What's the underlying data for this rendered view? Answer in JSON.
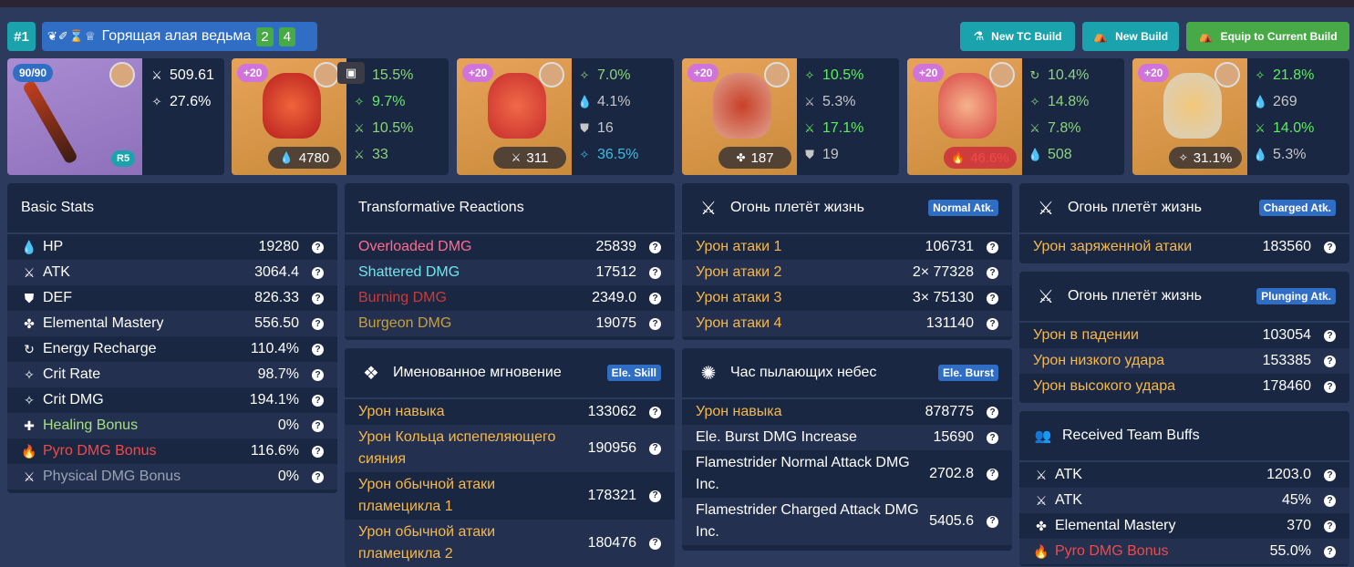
{
  "header": {
    "rank": "#1",
    "set_icons": "❦✐⌛♕",
    "set_name": "Горящая алая ведьма",
    "set_count_a": "2",
    "set_count_b": "4"
  },
  "buttons": {
    "new_tc": "New TC Build",
    "new_build": "New Build",
    "equip": "Equip to Current Build"
  },
  "weapon": {
    "level": "90/90",
    "refine": "R5",
    "stats": [
      {
        "icon": "⚔",
        "value": "509.61"
      },
      {
        "icon": "✧",
        "value": "27.6%"
      }
    ]
  },
  "artifacts": [
    {
      "level": "+20",
      "main": "4780",
      "main_icon": "💧",
      "subs": [
        {
          "icon": "✧",
          "value": "15.5%",
          "c": "gr"
        },
        {
          "icon": "✧",
          "value": "9.7%",
          "c": "bgr"
        },
        {
          "icon": "⚔",
          "value": "10.5%",
          "c": "gr"
        },
        {
          "icon": "⚔",
          "value": "33",
          "c": "gr"
        }
      ]
    },
    {
      "level": "+20",
      "main": "311",
      "main_icon": "⚔",
      "subs": [
        {
          "icon": "✧",
          "value": "7.0%",
          "c": "gr"
        },
        {
          "icon": "💧",
          "value": "4.1%",
          "c": "gy"
        },
        {
          "icon": "⛊",
          "value": "16",
          "c": "gy"
        },
        {
          "icon": "✧",
          "value": "36.5%",
          "c": "cy"
        }
      ]
    },
    {
      "level": "+20",
      "main": "187",
      "main_icon": "✤",
      "subs": [
        {
          "icon": "✧",
          "value": "10.5%",
          "c": "bgr"
        },
        {
          "icon": "⚔",
          "value": "5.3%",
          "c": "gy"
        },
        {
          "icon": "⚔",
          "value": "17.1%",
          "c": "bgr"
        },
        {
          "icon": "⛊",
          "value": "19",
          "c": "gy"
        }
      ]
    },
    {
      "level": "+20",
      "main": "46.6%",
      "main_icon": "🔥",
      "subs": [
        {
          "icon": "↻",
          "value": "10.4%",
          "c": "gr"
        },
        {
          "icon": "✧",
          "value": "14.8%",
          "c": "gr"
        },
        {
          "icon": "⚔",
          "value": "7.8%",
          "c": "gr"
        },
        {
          "icon": "💧",
          "value": "508",
          "c": "gr"
        }
      ]
    },
    {
      "level": "+20",
      "main": "31.1%",
      "main_icon": "✧",
      "subs": [
        {
          "icon": "✧",
          "value": "21.8%",
          "c": "bgr"
        },
        {
          "icon": "💧",
          "value": "269",
          "c": "gy"
        },
        {
          "icon": "⚔",
          "value": "14.0%",
          "c": "bgr"
        },
        {
          "icon": "💧",
          "value": "5.3%",
          "c": "gy"
        }
      ]
    }
  ],
  "basic": {
    "title": "Basic Stats",
    "rows": [
      {
        "icon": "💧",
        "label": "HP",
        "value": "19280"
      },
      {
        "icon": "⚔",
        "label": "ATK",
        "value": "3064.4"
      },
      {
        "icon": "⛊",
        "label": "DEF",
        "value": "826.33"
      },
      {
        "icon": "✤",
        "label": "Elemental Mastery",
        "value": "556.50"
      },
      {
        "icon": "↻",
        "label": "Energy Recharge",
        "value": "110.4%"
      },
      {
        "icon": "✧",
        "label": "Crit Rate",
        "value": "98.7%"
      },
      {
        "icon": "✧",
        "label": "Crit DMG",
        "value": "194.1%"
      },
      {
        "icon": "✚",
        "label": "Healing Bonus",
        "value": "0%"
      },
      {
        "icon": "🔥",
        "label": "Pyro DMG Bonus",
        "value": "116.6%"
      },
      {
        "icon": "⚔",
        "label": "Physical DMG Bonus",
        "value": "0%"
      }
    ]
  },
  "transform": {
    "title": "Transformative Reactions",
    "rows": [
      {
        "label": "Overloaded DMG",
        "value": "25839"
      },
      {
        "label": "Shattered DMG",
        "value": "17512"
      },
      {
        "label": "Burning DMG",
        "value": "2349.0"
      },
      {
        "label": "Burgeon DMG",
        "value": "19075"
      }
    ]
  },
  "skill": {
    "title": "Именованное мгновение",
    "badge": "Ele. Skill",
    "rows": [
      {
        "label": "Урон навыка",
        "value": "133062"
      },
      {
        "label": "Урон Кольца испепеляющего сияния",
        "value": "190956"
      },
      {
        "label": "Урон обычной атаки пламецикла 1",
        "value": "178321"
      },
      {
        "label": "Урон обычной атаки пламецикла 2",
        "value": "180476"
      }
    ]
  },
  "normal": {
    "title": "Огонь плетёт жизнь",
    "badge": "Normal Atk.",
    "rows": [
      {
        "label": "Урон атаки 1",
        "value": "106731"
      },
      {
        "label": "Урон атаки 2",
        "value": "2× 77328"
      },
      {
        "label": "Урон атаки 3",
        "value": "3× 75130"
      },
      {
        "label": "Урон атаки 4",
        "value": "131140"
      }
    ]
  },
  "burst": {
    "title": "Час пылающих небес",
    "badge": "Ele. Burst",
    "rows": [
      {
        "label": "Урон навыка",
        "value": "878775"
      },
      {
        "label": "Ele. Burst DMG Increase",
        "value": "15690"
      },
      {
        "label": "Flamestrider Normal Attack DMG Inc.",
        "value": "2702.8"
      },
      {
        "label": "Flamestrider Charged Attack DMG Inc.",
        "value": "5405.6"
      }
    ]
  },
  "charged": {
    "title": "Огонь плетёт жизнь",
    "badge": "Charged Atk.",
    "rows": [
      {
        "label": "Урон заряженной атаки",
        "value": "183560"
      }
    ]
  },
  "plunge": {
    "title": "Огонь плетёт жизнь",
    "badge": "Plunging Atk.",
    "rows": [
      {
        "label": "Урон в падении",
        "value": "103054"
      },
      {
        "label": "Урон низкого удара",
        "value": "153385"
      },
      {
        "label": "Урон высокого удара",
        "value": "178460"
      }
    ]
  },
  "team": {
    "title": "Received Team Buffs",
    "rows": [
      {
        "icon": "⚔",
        "label": "ATK",
        "value": "1203.0"
      },
      {
        "icon": "⚔",
        "label": "ATK",
        "value": "45%"
      },
      {
        "icon": "✤",
        "label": "Elemental Mastery",
        "value": "370"
      },
      {
        "icon": "🔥",
        "label": "Pyro DMG Bonus",
        "value": "55.0%"
      }
    ]
  },
  "colors": {
    "accent": "#1aa3ad",
    "green": "#48a947",
    "blue": "#2f6ec4",
    "orange": "#f7b84b",
    "highlight": "#e0111b"
  }
}
